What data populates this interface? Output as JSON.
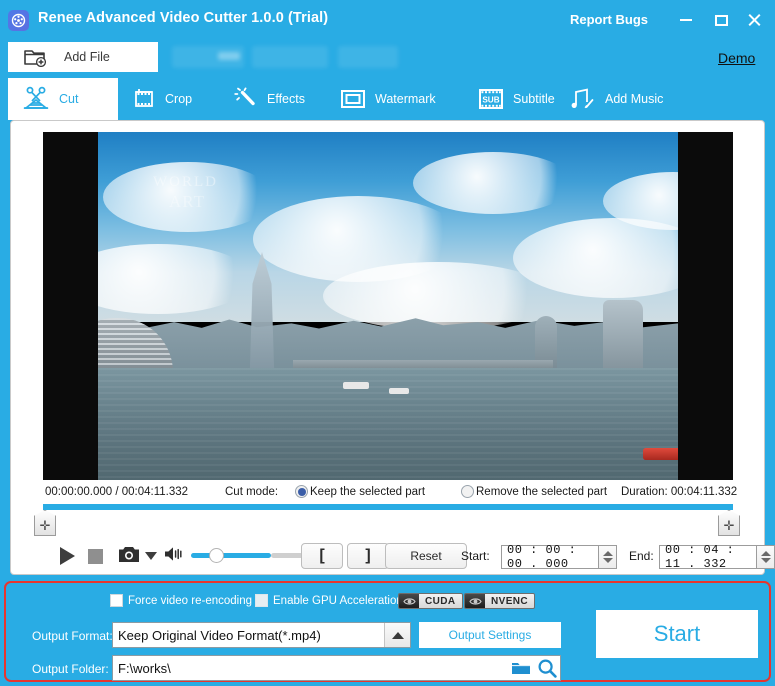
{
  "window": {
    "app_icon": "film-reel-icon",
    "title": "Renee Advanced Video Cutter 1.0.0 (Trial)",
    "report_bugs": "Report Bugs",
    "minimize": "minimize-icon",
    "maximize": "maximize-icon",
    "close": "close-icon"
  },
  "toolbar": {
    "add_file_label": "Add File",
    "add_file_icon": "add-file-icon",
    "demo_label": "Demo"
  },
  "tabs": [
    {
      "label": "Cut",
      "icon": "scissors-film-icon",
      "active": true
    },
    {
      "label": "Crop",
      "icon": "film-frame-icon",
      "active": false
    },
    {
      "label": "Effects",
      "icon": "magic-wand-icon",
      "active": false
    },
    {
      "label": "Watermark",
      "icon": "rectangle-frame-icon",
      "active": false
    },
    {
      "label": "Subtitle",
      "icon": "sub-film-icon",
      "active": false
    },
    {
      "label": "Add Music",
      "icon": "music-note-pencil-icon",
      "active": false
    }
  ],
  "preview": {
    "watermark_line1": "WORLD",
    "watermark_line2": "ART"
  },
  "info": {
    "time_position": "00:00:00.000 / 00:04:11.332",
    "cut_mode_label": "Cut mode:",
    "cut_mode_options": [
      {
        "label": "Keep the selected part",
        "selected": true
      },
      {
        "label": "Remove the selected part",
        "selected": false
      }
    ],
    "duration": "Duration: 00:04:11.332"
  },
  "controls": {
    "play": "play-icon",
    "stop": "stop-icon",
    "snapshot": "camera-icon",
    "snapshot_caret": "chevron-down-icon",
    "volume": "volume-icon",
    "volume_value": 70,
    "mark_in": "[",
    "mark_out": "]",
    "reset_label": "Reset",
    "start_label": "Start:",
    "start_value": "00 : 00 : 00 . 000",
    "end_label": "End:",
    "end_value": "00 : 04 : 11 . 332",
    "trim_handle_left": "trim-handle-left-icon",
    "trim_handle_right": "trim-handle-right-icon"
  },
  "output": {
    "force_reencode_label": "Force video re-encoding",
    "force_reencode_checked": false,
    "gpu_accel_label": "Enable GPU Acceleration",
    "gpu_accel_checked": false,
    "badge_cuda": "CUDA",
    "badge_nvenc": "NVENC",
    "format_label": "Output Format:",
    "format_value": "Keep Original Video Format(*.mp4)",
    "format_caret": "chevron-up-icon",
    "output_settings_label": "Output Settings",
    "folder_label": "Output Folder:",
    "folder_value": "F:\\works\\",
    "folder_browse_icon": "folder-icon",
    "folder_search_icon": "search-icon",
    "start_label": "Start"
  },
  "colors": {
    "brand_blue": "#29ace4",
    "highlight_red": "#e8352e",
    "panel_white": "#ffffff"
  }
}
